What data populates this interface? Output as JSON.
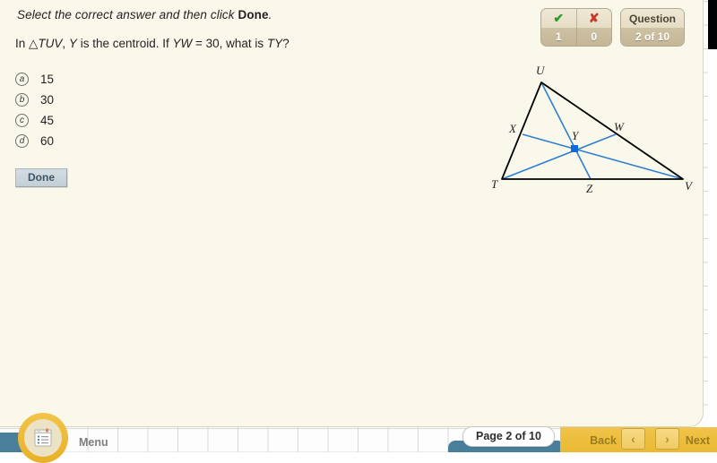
{
  "instruction": {
    "prefix": "Select the correct answer and then click ",
    "emphasis": "Done",
    "suffix": "."
  },
  "question": {
    "text_parts": {
      "p1": "In △",
      "v1": "TUV",
      "p2": ", ",
      "v2": "Y",
      "p3": " is the centroid. If ",
      "v3": "YW",
      "p4": " = 30, what is ",
      "v4": "TY",
      "p5": "?"
    },
    "full_text": "In △TUV, Y is the centroid. If YW = 30, what is TY?"
  },
  "choices": [
    {
      "letter": "a",
      "value": "15"
    },
    {
      "letter": "b",
      "value": "30"
    },
    {
      "letter": "c",
      "value": "45"
    },
    {
      "letter": "d",
      "value": "60"
    }
  ],
  "done_button": {
    "label": "Done"
  },
  "score": {
    "correct_icon": "check-icon",
    "wrong_icon": "cross-icon",
    "correct_mark": "✔",
    "wrong_mark": "✘",
    "correct_count": "1",
    "wrong_count": "0",
    "correct_color": "#2f9b2f",
    "wrong_color": "#c43b2a"
  },
  "question_badge": {
    "title": "Question",
    "value": "2 of 10"
  },
  "diagram": {
    "shape": "triangle-with-medians",
    "stroke_black": "#000000",
    "stroke_blue": "#2f7fd1",
    "centroid_color": "#1168d8",
    "labels": {
      "U": "U",
      "T": "T",
      "V": "V",
      "X": "X",
      "W": "W",
      "Y": "Y",
      "Z": "Z"
    }
  },
  "footer": {
    "menu_label": "Menu",
    "menu_icon": "notepad-icon",
    "page_label": "Page  2 of 10",
    "back_label": "Back",
    "next_label": "Next",
    "back_arrow": "‹",
    "next_arrow": "›"
  }
}
